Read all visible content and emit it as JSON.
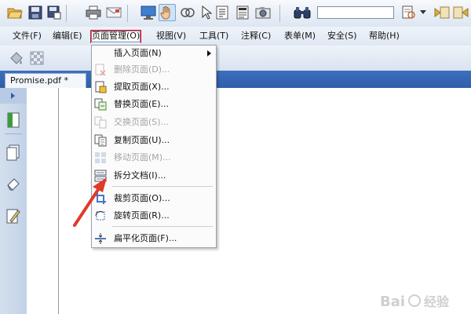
{
  "document_tab": {
    "label": "Promise.pdf *"
  },
  "menubar": {
    "items": [
      {
        "label": "文件(F)"
      },
      {
        "label": "编辑(E)"
      },
      {
        "label": "页面管理(O)"
      },
      {
        "label": "视图(V)"
      },
      {
        "label": "工具(T)"
      },
      {
        "label": "注释(C)"
      },
      {
        "label": "表单(M)"
      },
      {
        "label": "安全(S)"
      },
      {
        "label": "帮助(H)"
      }
    ]
  },
  "dropdown": {
    "items": [
      {
        "label": "插入页面(N)",
        "icon": "insert-page-icon",
        "enabled": true,
        "submenu": true
      },
      {
        "label": "删除页面(D)...",
        "icon": "delete-page-icon",
        "enabled": false
      },
      {
        "label": "提取页面(X)...",
        "icon": "extract-page-icon",
        "enabled": true
      },
      {
        "label": "替换页面(E)...",
        "icon": "replace-page-icon",
        "enabled": true
      },
      {
        "label": "交换页面(S)...",
        "icon": "swap-page-icon",
        "enabled": false
      },
      {
        "label": "复制页面(U)...",
        "icon": "copy-page-icon",
        "enabled": true
      },
      {
        "label": "移动页面(M)...",
        "icon": "move-page-icon",
        "enabled": false
      },
      {
        "label": "拆分文档(I)...",
        "icon": "split-document-icon",
        "enabled": true
      },
      {
        "label": "裁剪页面(O)...",
        "icon": "crop-page-icon",
        "enabled": true
      },
      {
        "label": "旋转页面(R)...",
        "icon": "rotate-page-icon",
        "enabled": true
      },
      {
        "label": "扁平化页面(F)...",
        "icon": "flatten-page-icon",
        "enabled": true
      }
    ]
  },
  "watermark": {
    "text": "Bai 经验"
  },
  "colors": {
    "accent": "#2f5ea8",
    "annotation": "#e03a2a",
    "open_menu_border": "#ff0000"
  }
}
